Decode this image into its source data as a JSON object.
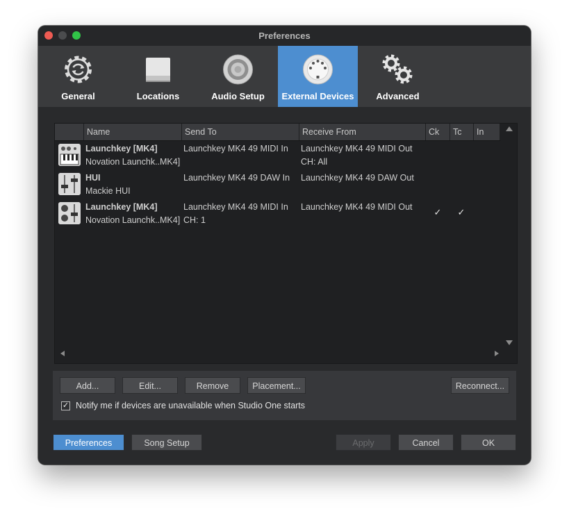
{
  "window": {
    "title": "Preferences"
  },
  "toolbar": {
    "tabs": [
      {
        "label": "General",
        "icon": "gear-refresh-icon"
      },
      {
        "label": "Locations",
        "icon": "drive-icon"
      },
      {
        "label": "Audio Setup",
        "icon": "speaker-icon"
      },
      {
        "label": "External Devices",
        "icon": "midi-port-icon",
        "active": true
      },
      {
        "label": "Advanced",
        "icon": "gears-icon"
      }
    ]
  },
  "table": {
    "columns": [
      "Name",
      "Send To",
      "Receive From",
      "Ck",
      "Tc",
      "In"
    ],
    "rows": [
      {
        "icon": "keyboard-icon",
        "name": "Launchkey [MK4]",
        "subname": "Novation Launchk..MK4]",
        "send_to": "Launchkey MK4 49 MIDI In",
        "send_to_sub": "",
        "receive_from": "Launchkey MK4 49 MIDI Out",
        "receive_sub": "CH: All",
        "ck": false,
        "tc": false
      },
      {
        "icon": "fader-icon",
        "name": "HUI",
        "subname": "Mackie HUI",
        "send_to": "Launchkey MK4 49 DAW In",
        "send_to_sub": "",
        "receive_from": "Launchkey MK4 49 DAW Out",
        "receive_sub": "",
        "ck": false,
        "tc": false
      },
      {
        "icon": "knob-fader-icon",
        "name": "Launchkey [MK4]",
        "subname": "Novation Launchk..MK4]",
        "send_to": "Launchkey MK4 49 MIDI In",
        "send_to_sub": "CH: 1",
        "receive_from": "Launchkey MK4 49 MIDI Out",
        "receive_sub": "",
        "ck": true,
        "tc": true
      }
    ]
  },
  "actions": {
    "add": "Add...",
    "edit": "Edit...",
    "remove": "Remove",
    "placement": "Placement...",
    "reconnect": "Reconnect...",
    "notify_label": "Notify me if devices are unavailable when Studio One starts",
    "notify_checked": true
  },
  "footer": {
    "preferences": "Preferences",
    "song_setup": "Song Setup",
    "apply": "Apply",
    "cancel": "Cancel",
    "ok": "OK"
  },
  "colors": {
    "accent": "#4d8ed0",
    "background": "#2a2b2d",
    "toolbar": "#3a3b3d"
  }
}
